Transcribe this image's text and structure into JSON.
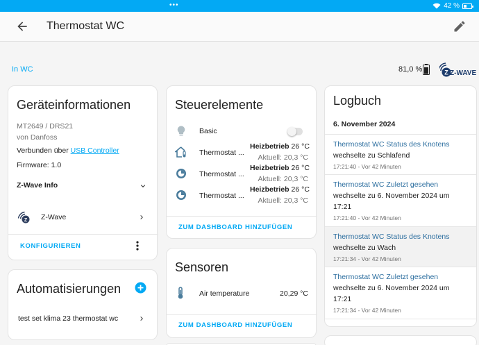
{
  "status_bar": {
    "dots": "•••",
    "battery": "42 %",
    "battery_level": 0.42
  },
  "header": {
    "title": "Thermostat WC"
  },
  "device_meta": {
    "area": "In WC",
    "battery": "81,0 %",
    "battery_level": 0.81,
    "integration_logo": "Z-WAVE"
  },
  "device_info": {
    "title": "Geräteinformationen",
    "model": "MT2649 / DRS21",
    "manufacturer": "von Danfoss",
    "connected_prefix": "Verbunden über",
    "connected_link": "USB Controller",
    "firmware": "Firmware: 1.0",
    "zwave_info": "Z-Wave Info",
    "integration": "Z-Wave",
    "configure": "KONFIGURIEREN"
  },
  "automations": {
    "title": "Automatisierungen",
    "items": [
      "test set klima 23 thermostat wc"
    ]
  },
  "controls": {
    "title": "Steuerelemente",
    "rows": [
      {
        "name": "Basic",
        "type": "toggle",
        "state": "off"
      },
      {
        "name": "Thermostat ...",
        "mode": "Heizbetrieb",
        "target": "26 °C",
        "current": "Aktuell: 20,3 °C"
      },
      {
        "name": "Thermostat ...",
        "mode": "Heizbetrieb",
        "target": "26 °C",
        "current": "Aktuell: 20,3 °C"
      },
      {
        "name": "Thermostat ...",
        "mode": "Heizbetrieb",
        "target": "26 °C",
        "current": "Aktuell: 20,3 °C"
      }
    ],
    "add_to_dashboard": "ZUM DASHBOARD HINZUFÜGEN"
  },
  "sensors": {
    "title": "Sensoren",
    "rows": [
      {
        "name": "Air temperature",
        "value": "20,29 °C"
      }
    ],
    "add_to_dashboard": "ZUM DASHBOARD HINZUFÜGEN"
  },
  "logbook": {
    "title": "Logbuch",
    "date": "6. November 2024",
    "entries": [
      {
        "title": "Thermostat WC Status des Knotens",
        "desc": "wechselte zu Schlafend",
        "time": "17:21:40 - Vor 42 Minuten"
      },
      {
        "title": "Thermostat WC Zuletzt gesehen",
        "desc": "wechselte zu 6. November 2024 um 17:21",
        "time": "17:21:40 - Vor 42 Minuten"
      },
      {
        "title": "Thermostat WC Status des Knotens",
        "desc": "wechselte zu Wach",
        "time": "17:21:34 - Vor 42 Minuten"
      },
      {
        "title": "Thermostat WC Zuletzt gesehen",
        "desc": "wechselte zu 6. November 2024 um 17:21",
        "time": "17:21:34 - Vor 42 Minuten"
      }
    ]
  },
  "colors": {
    "accent": "#03a9f4",
    "link": "#2c6e9f",
    "icon": "#4a7c9c",
    "text": "#212121"
  }
}
